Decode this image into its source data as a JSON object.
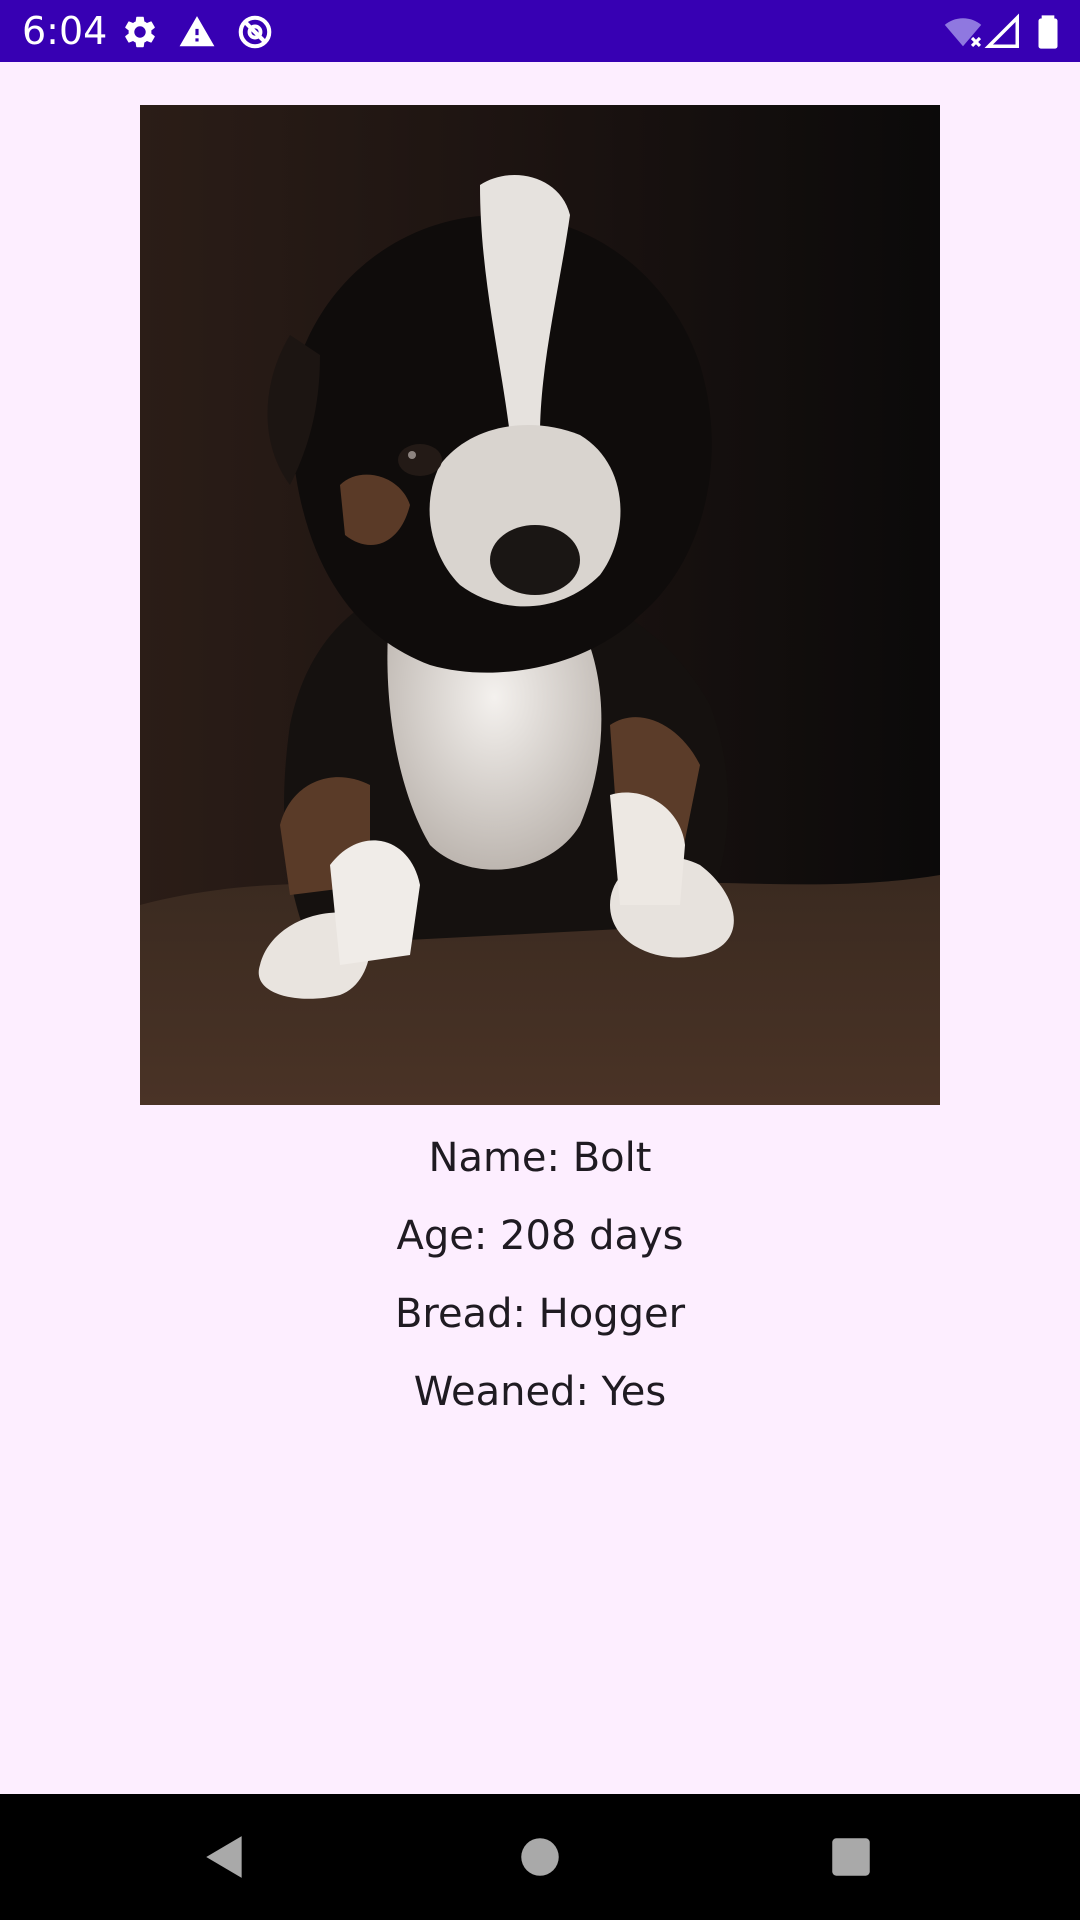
{
  "status_bar": {
    "time": "6:04",
    "icons": [
      "settings-icon",
      "warning-icon",
      "sync-off-icon",
      "wifi-off-icon",
      "signal-icon",
      "battery-icon"
    ],
    "background_color": "#3700b3"
  },
  "pet": {
    "name_line": "Name: Bolt",
    "age_line": "Age: 208 days",
    "breed_line": "Bread: Hogger",
    "weaned_line": "Weaned: Yes"
  },
  "nav_bar": {
    "buttons": [
      "back-icon",
      "home-icon",
      "recents-icon"
    ]
  },
  "colors": {
    "background": "#fdeeff",
    "text": "#1f1b22"
  }
}
